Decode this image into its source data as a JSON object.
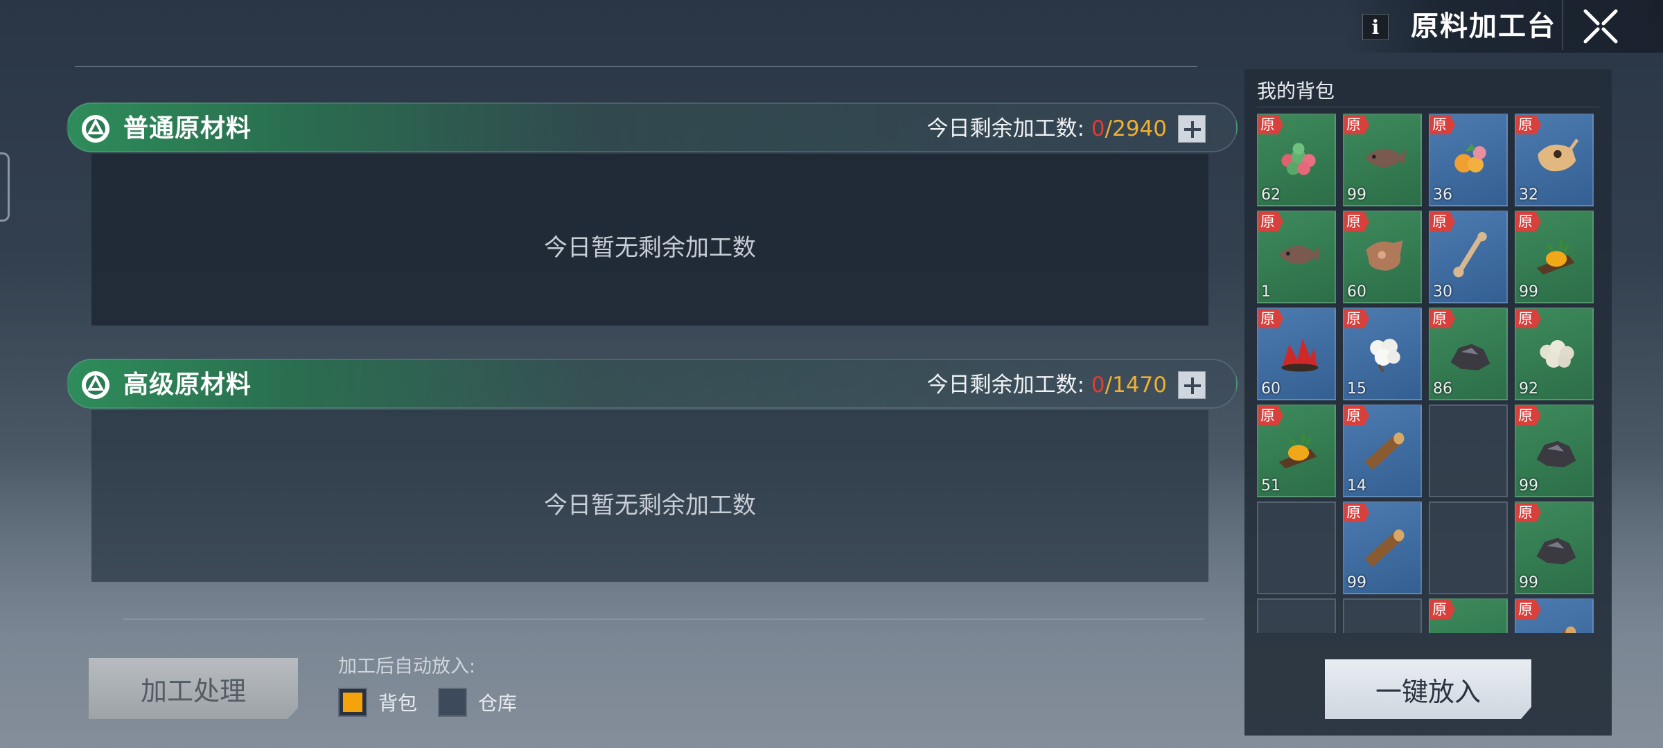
{
  "header": {
    "info_label": "i",
    "title": "原料加工台"
  },
  "sections": [
    {
      "title": "普通原材料",
      "quota_label": "今日剩余加工数:",
      "quota_current": "0",
      "quota_max": "/2940",
      "empty_text": "今日暂无剩余加工数"
    },
    {
      "title": "高级原材料",
      "quota_label": "今日剩余加工数:",
      "quota_current": "0",
      "quota_max": "/1470",
      "empty_text": "今日暂无剩余加工数"
    }
  ],
  "process": {
    "button_label": "加工处理",
    "auto_label": "加工后自动放入:",
    "options": [
      {
        "label": "背包",
        "selected": true
      },
      {
        "label": "仓库",
        "selected": false
      }
    ]
  },
  "bag": {
    "title": "我的背包",
    "tag_label": "原",
    "items": [
      {
        "icon": "berry-cluster-icon",
        "count": "62",
        "bg": "green"
      },
      {
        "icon": "fish-icon",
        "count": "99",
        "bg": "green"
      },
      {
        "icon": "fruit-icon",
        "count": "36",
        "bg": "blue"
      },
      {
        "icon": "animal-skull-icon",
        "count": "32",
        "bg": "blue"
      },
      {
        "icon": "fish-icon",
        "count": "1",
        "bg": "green"
      },
      {
        "icon": "animal-hide-icon",
        "count": "60",
        "bg": "green"
      },
      {
        "icon": "bone-icon",
        "count": "30",
        "bg": "blue"
      },
      {
        "icon": "amber-resin-icon",
        "count": "99",
        "bg": "green"
      },
      {
        "icon": "red-crystal-icon",
        "count": "60",
        "bg": "blue"
      },
      {
        "icon": "cotton-icon",
        "count": "15",
        "bg": "blue"
      },
      {
        "icon": "ore-rock-icon",
        "count": "86",
        "bg": "green"
      },
      {
        "icon": "wool-icon",
        "count": "92",
        "bg": "green"
      },
      {
        "icon": "amber-resin-icon",
        "count": "51",
        "bg": "green"
      },
      {
        "icon": "wood-log-icon",
        "count": "14",
        "bg": "blue"
      },
      {
        "icon": "",
        "count": "",
        "bg": "empty"
      },
      {
        "icon": "ore-rock-icon",
        "count": "99",
        "bg": "green"
      },
      {
        "icon": "",
        "count": "",
        "bg": "empty"
      },
      {
        "icon": "wood-log-icon",
        "count": "99",
        "bg": "blue"
      },
      {
        "icon": "",
        "count": "",
        "bg": "empty"
      },
      {
        "icon": "ore-rock-icon",
        "count": "99",
        "bg": "green"
      },
      {
        "icon": "",
        "count": "",
        "bg": "empty"
      },
      {
        "icon": "",
        "count": "",
        "bg": "empty"
      },
      {
        "icon": "ore-rock-icon",
        "count": "",
        "bg": "green"
      },
      {
        "icon": "wood-log-icon",
        "count": "",
        "bg": "blue"
      }
    ],
    "one_click_label": "一键放入"
  },
  "colors": {
    "quota_current": "#e43a34",
    "quota_max": "#f0b030",
    "tag": "#d8403c",
    "selected_option": "#f5a30a"
  }
}
